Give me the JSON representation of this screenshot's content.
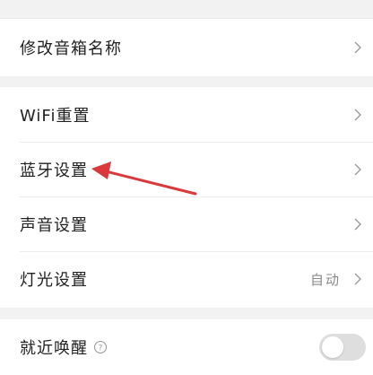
{
  "settings": {
    "rename": {
      "label": "修改音箱名称"
    },
    "wifi_reset": {
      "label": "WiFi重置"
    },
    "bluetooth": {
      "label": "蓝牙设置"
    },
    "sound": {
      "label": "声音设置"
    },
    "light": {
      "label": "灯光设置",
      "value": "自动"
    },
    "near_wake": {
      "label": "就近唤醒",
      "enabled": false
    }
  },
  "colors": {
    "annotation_arrow": "#d9393b",
    "toggle_off": "#dedede"
  },
  "icons": {
    "chevron": "chevron-right-icon",
    "help": "question-circle-icon",
    "arrow": "annotation-arrow-icon"
  }
}
